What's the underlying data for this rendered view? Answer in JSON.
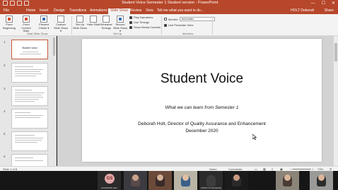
{
  "window": {
    "title": "Student Voice Semester 1 Student version  -  PowerPoint",
    "user": "HOLT Deborah",
    "controls": [
      "—",
      "☐",
      "✕"
    ]
  },
  "menu": {
    "tabs": [
      "File",
      "Home",
      "Insert",
      "Design",
      "Transitions",
      "Animations",
      "Slide Show",
      "Review",
      "View"
    ],
    "active_tab": "Slide Show",
    "tell_me": "Tell me what you want to do...",
    "share": "Share"
  },
  "ribbon": {
    "start_group": {
      "from_beginning": "From Beginning",
      "from_current": "From Current Slide",
      "present_online": "Present Online ▾",
      "custom_show": "Custom Slide Show ▾",
      "label": "Start Slide Show"
    },
    "setup_group": {
      "set_up": "Set Up Slide Show",
      "hide_slide": "Hide Slide",
      "rehearse": "Rehearse Timings",
      "record": "Record Slide Show ▾",
      "play_narrations": "Play Narrations",
      "use_timings": "Use Timings",
      "show_media_controls": "Show Media Controls",
      "label": "Set Up"
    },
    "monitors_group": {
      "monitor_label": "Monitor:",
      "monitor_value": "Automatic",
      "presenter_view": "Use Presenter View",
      "label": "Monitors"
    }
  },
  "thumbnails": [
    {
      "num": "1",
      "title": "Student Voice"
    },
    {
      "num": "2",
      "title": ""
    },
    {
      "num": "3",
      "title": ""
    },
    {
      "num": "4",
      "title": ""
    },
    {
      "num": "5",
      "title": ""
    },
    {
      "num": "6",
      "title": ""
    }
  ],
  "slide": {
    "title": "Student Voice",
    "subtitle": "What we can learn from Semester 1",
    "author": "Deborah Holt, Director of Quality Assurance and Enhancement",
    "date": "December 2020"
  },
  "status": {
    "slide_count": "Slide 1 of 8",
    "notes": "Notes",
    "comments": "Comments",
    "zoom": "73%"
  },
  "video": {
    "participants": [
      {
        "initials": "GS",
        "name": "GOODMAN Sian"
      },
      {
        "name": ""
      },
      {
        "name": ""
      },
      {
        "name": ""
      },
      {
        "name": "FORSYTH Samantha"
      },
      {
        "name": ""
      },
      {
        "name": ""
      },
      {
        "name": ""
      }
    ]
  },
  "colors": {
    "accent": "#b7472a",
    "ribbon_bg": "#f3f3f3",
    "thumb_pane": "#e6e6e6",
    "edit_bg": "#d3d3d3"
  }
}
